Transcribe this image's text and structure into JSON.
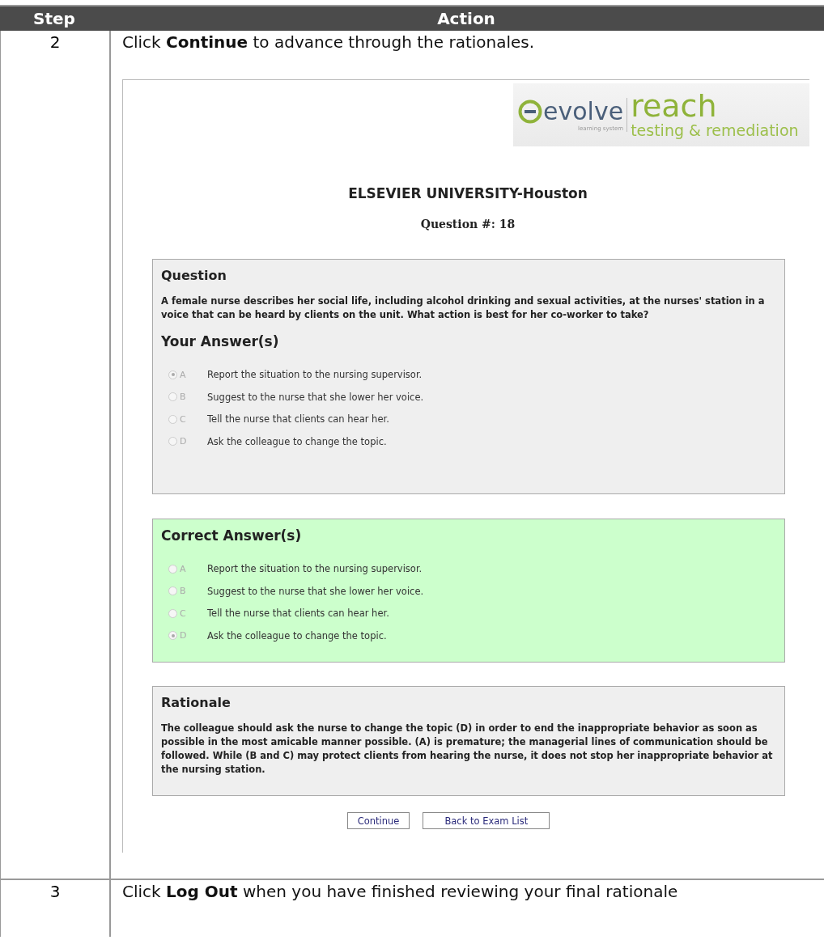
{
  "table": {
    "columns": [
      "Step",
      "Action"
    ],
    "rows": [
      {
        "step": "2",
        "instruction": "Click **Continue** to advance through the rationales.",
        "screenshot": {
          "logo": {
            "mark": "evolve",
            "tagline": "learning system",
            "product": "reach",
            "subtitle": "testing & remediation"
          },
          "school": "ELSEVIER UNIVERSITY-Houston",
          "question_number": "Question #: 18",
          "question_panel": {
            "title": "Question",
            "text": "A female nurse describes her social life, including alcohol drinking and sexual activities, at the nurses' station in a voice that can be heard by clients on the unit.  What action is best for her co-worker to take?",
            "answers_title": "Your Answer(s)",
            "options": [
              {
                "letter": "A",
                "text": "Report the situation to the nursing supervisor.",
                "selected": true
              },
              {
                "letter": "B",
                "text": "Suggest to the nurse that she lower her voice.",
                "selected": false
              },
              {
                "letter": "C",
                "text": "Tell the nurse that clients can hear her.",
                "selected": false
              },
              {
                "letter": "D",
                "text": "Ask the colleague to change the topic.",
                "selected": false
              }
            ]
          },
          "correct_panel": {
            "title": "Correct Answer(s)",
            "options": [
              {
                "letter": "A",
                "text": "Report the situation to the nursing supervisor.",
                "selected": false
              },
              {
                "letter": "B",
                "text": "Suggest to the nurse that she lower her voice.",
                "selected": false
              },
              {
                "letter": "C",
                "text": "Tell the nurse that clients can hear her.",
                "selected": false
              },
              {
                "letter": "D",
                "text": "Ask the colleague to change the topic.",
                "selected": true
              }
            ]
          },
          "rationale_panel": {
            "title": "Rationale",
            "text": "The colleague should ask the nurse to change the topic (D) in order to end the inappropriate behavior as soon as possible in the most amicable manner possible.  (A) is premature; the managerial lines of communication should be followed.  While (B and C) may protect clients from hearing the nurse, it does not stop her inappropriate behavior at the nursing station."
          },
          "buttons": [
            "Continue",
            "Back to Exam List"
          ]
        }
      },
      {
        "step": "3",
        "instruction": "Click **Log Out** when you have finished reviewing your final rationale"
      }
    ]
  }
}
